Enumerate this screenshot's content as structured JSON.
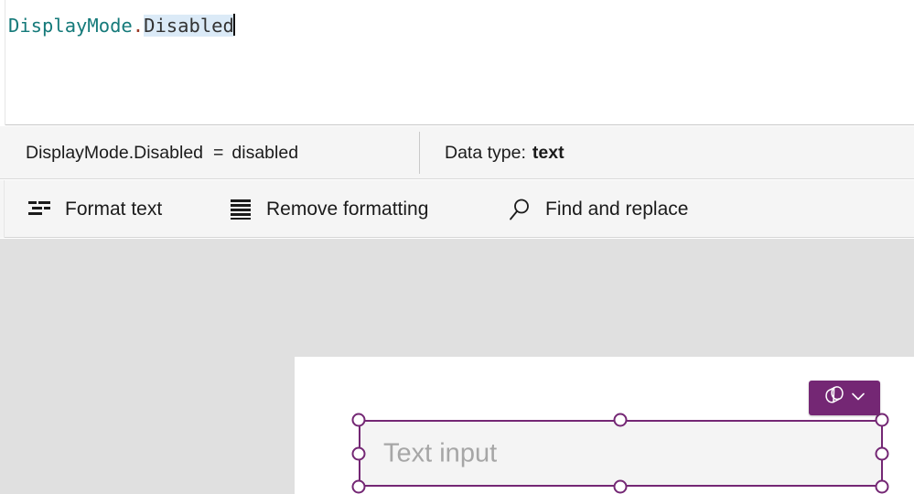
{
  "formula": {
    "enum_name": "DisplayMode",
    "dot": ".",
    "member": "Disabled",
    "full_text": "DisplayMode.Disabled",
    "selection_highlight_color": "#dbeaf7",
    "enum_color": "#157a7a",
    "member_color": "#333333",
    "dot_color": "#9b3a26",
    "caret_visible": true
  },
  "info_bar": {
    "expression": "DisplayMode.Disabled",
    "equals": "=",
    "value": "disabled",
    "data_type_label": "Data type:",
    "data_type_value": "text"
  },
  "toolbar": {
    "items": [
      {
        "label": "Format text",
        "icon": "format-text-icon"
      },
      {
        "label": "Remove formatting",
        "icon": "remove-formatting-icon"
      },
      {
        "label": "Find and replace",
        "icon": "search-icon"
      }
    ]
  },
  "canvas": {
    "background_color": "#e0e0e0",
    "screen_background_color": "#ffffff",
    "control": {
      "type": "text-input",
      "placeholder": "Text input",
      "fill_color": "#f4f4f4",
      "selected": true,
      "selection_color": "#742774",
      "handle_count": 6
    },
    "property_badge": {
      "icon": "power-apps-properties-icon",
      "chevron": "chevron-down-icon",
      "background_color": "#742774"
    }
  }
}
